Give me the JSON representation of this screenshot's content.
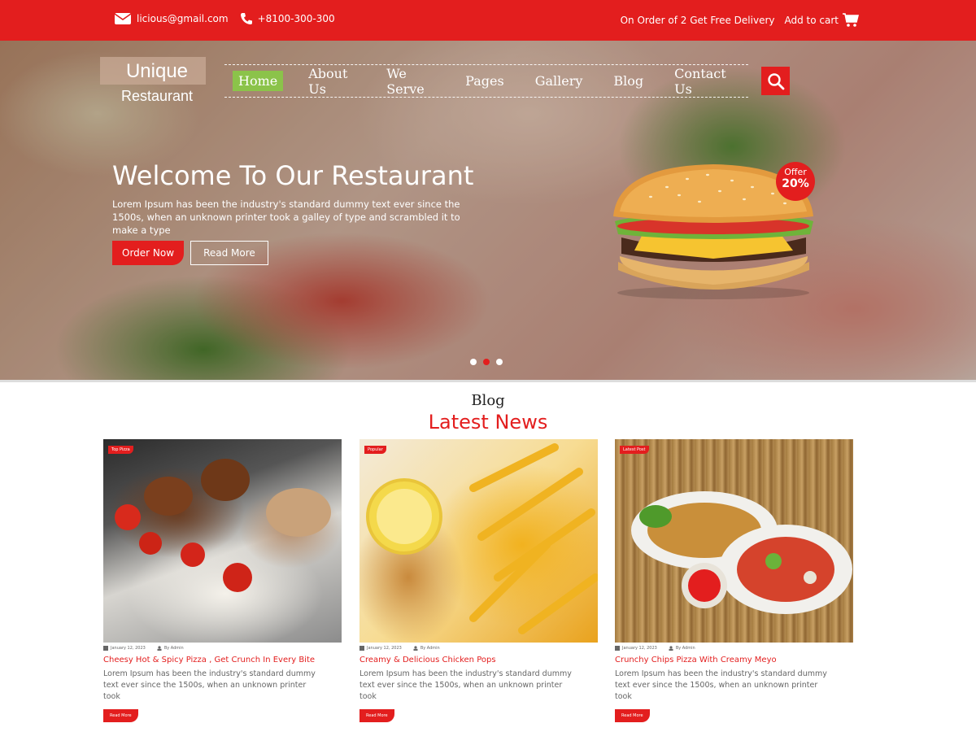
{
  "topbar": {
    "email": "licious@gmail.com",
    "phone": "+8100-300-300",
    "promo": "On Order of 2 Get Free Delivery",
    "cart_label": "Add to cart",
    "bg_color": "#e31e1e"
  },
  "logo": {
    "line1": "Unique",
    "line2": "Restaurant"
  },
  "nav": {
    "items": [
      {
        "label": "Home",
        "active": true
      },
      {
        "label": "About Us"
      },
      {
        "label": "We Serve"
      },
      {
        "label": "Pages"
      },
      {
        "label": "Gallery"
      },
      {
        "label": "Blog"
      },
      {
        "label": "Contact Us"
      }
    ],
    "active_color": "#8bc34a"
  },
  "hero": {
    "title": "Welcome To Our Restaurant",
    "text": "Lorem Ipsum has been the industry's standard dummy text ever since the 1500s, when an unknown printer took a galley of type and scrambled it to make a type",
    "order_btn": "Order Now",
    "read_btn": "Read More",
    "offer_label": "Offer",
    "offer_value": "20%",
    "slides": 3,
    "active_slide": 2
  },
  "blog": {
    "kicker": "Blog",
    "heading": "Latest News",
    "posts": [
      {
        "tag": "Top Pizza",
        "date": "January 12, 2023",
        "author": "By Admin",
        "title": "Cheesy Hot & Spicy Pizza , Get Crunch In Every Bite",
        "desc": "Lorem Ipsum has been the industry's standard dummy text ever since the 1500s, when an unknown printer took",
        "more": "Read More"
      },
      {
        "tag": "Popular",
        "date": "January 12, 2023",
        "author": "By Admin",
        "title": "Creamy & Delicious Chicken Pops",
        "desc": "Lorem Ipsum has been the industry's standard dummy text ever since the 1500s, when an unknown printer took",
        "more": "Read More"
      },
      {
        "tag": "Latest Post",
        "date": "January 12, 2023",
        "author": "By Admin",
        "title": "Crunchy Chips Pizza With Creamy Meyo",
        "desc": "Lorem Ipsum has been the industry's standard dummy text ever since the 1500s, when an unknown printer took",
        "more": "Read More"
      }
    ]
  },
  "icons": [
    "envelope-icon",
    "phone-icon",
    "cart-icon",
    "search-icon",
    "calendar-icon",
    "user-icon"
  ]
}
